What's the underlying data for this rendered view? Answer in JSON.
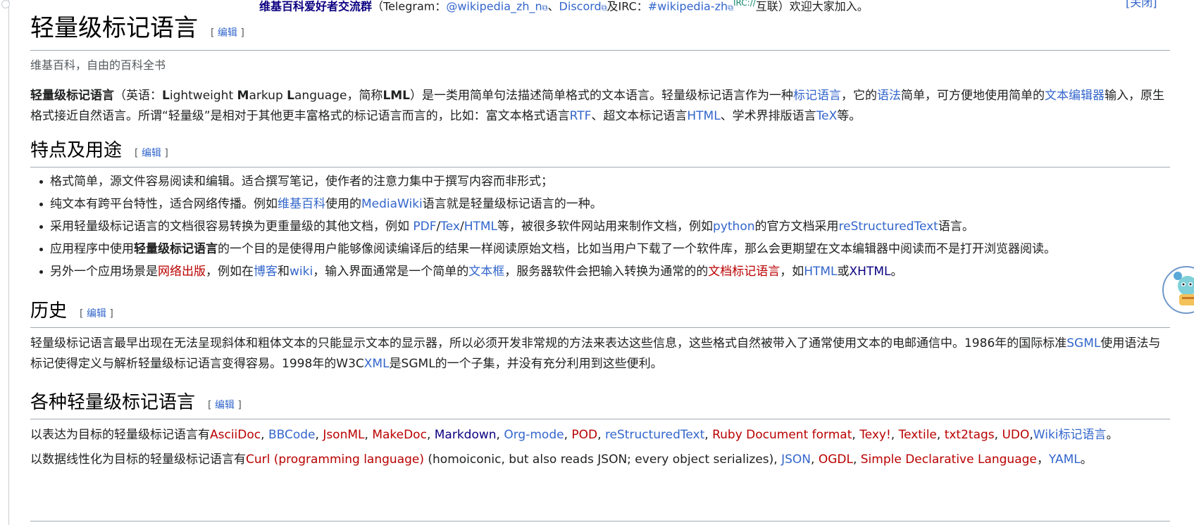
{
  "sitenotice": {
    "community": "维基百科爱好者交流群",
    "open_paren": "（Telegram：",
    "telegram": "@wikipedia_zh_n",
    "sep1": "、",
    "discord": "Discord",
    "irc_prefix": "及IRC：",
    "irc": "#wikipedia-zh",
    "irc_sup": "IRC://",
    "tail": "互联）欢迎大家加入。",
    "close": "[关闭]"
  },
  "edit_label": "编辑",
  "page": {
    "title": "轻量级标记语言",
    "tagline": "维基百科，自由的百科全书"
  },
  "lead": {
    "term": "轻量级标记语言",
    "t1": "（英语：",
    "eng_L": "L",
    "eng_ightweight": "ightweight ",
    "eng_M": "M",
    "eng_arkup": "arkup ",
    "eng_L2": "L",
    "eng_anguage": "anguage",
    "t2": "，简称",
    "abbr": "LML",
    "t3": "）是一类用简单句法描述简单格式的文本语言。轻量级标记语言作为一种",
    "link_markup": "标记语言",
    "t4": "，它的",
    "link_syntax": "语法",
    "t5": "简单，可方便地使用简单的",
    "link_editor": "文本编辑器",
    "t6": "输入，原生格式接近自然语言。所谓“轻量级”是相对于其他更丰富格式的标记语言而言的，比如：富文本格式语言",
    "link_rtf": "RTF",
    "t7": "、超文本标记语言",
    "link_html": "HTML",
    "t8": "、学术界排版语言",
    "link_tex": "TeX",
    "t9": "等。"
  },
  "features": {
    "heading": "特点及用途",
    "b1": "格式简单，源文件容易阅读和编辑。适合撰写笔记，使作者的注意力集中于撰写内容而非形式；",
    "b2_t1": "纯文本有跨平台特性，适合网络传播。例如",
    "b2_link_wp": "维基百科",
    "b2_t2": "使用的",
    "b2_link_mw": "MediaWiki",
    "b2_t3": "语言就是轻量级标记语言的一种。",
    "b3_t1": "采用轻量级标记语言的文档很容易转换为更重量级的其他文档，例如 ",
    "b3_pdf": "PDF",
    "b3_slash1": "/",
    "b3_tex": "Tex",
    "b3_slash2": "/",
    "b3_html": "HTML",
    "b3_t2": "等，被很多软件网站用来制作文档，例如",
    "b3_python": "python",
    "b3_t3": "的官方文档采用",
    "b3_rst": "reStructuredText",
    "b3_t4": "语言。",
    "b4_t1": "应用程序中使用",
    "b4_bold": "轻量级标记语言",
    "b4_t2": "的一个目的是使得用户能够像阅读编译后的结果一样阅读原始文档，比如当用户下载了一个软件库，那么会更期望在文本编辑器中阅读而不是打开浏览器阅读。",
    "b5_t1": "另外一个应用场景是",
    "b5_publish": "网络出版",
    "b5_t2": "，例如在",
    "b5_blog": "博客",
    "b5_and": "和",
    "b5_wiki": "wiki",
    "b5_t3": "，输入界面通常是一个简单的",
    "b5_textbox": "文本框",
    "b5_t4": "，服务器软件会把输入转换为通常的的",
    "b5_docmarkup": "文档标记语言",
    "b5_t5": "，如",
    "b5_html": "HTML",
    "b5_or": "或",
    "b5_xhtml": "XHTML",
    "b5_end": "。"
  },
  "history": {
    "heading": "历史",
    "t1": "轻量级标记语言最早出现在无法呈现斜体和粗体文本的只能显示文本的显示器，所以必须开发非常规的方法来表达这些信息，这些格式自然被带入了通常使用文本的电邮通信中。1986年的国际标准",
    "sgml": "SGML",
    "t2": "使用语法与标记使得定义与解析轻量级标记语言变得容易。1998年的W3C",
    "xml": "XML",
    "t3": "是SGML的一个子集，并没有充分利用到这些便利。"
  },
  "kinds": {
    "heading": "各种轻量级标记语言",
    "p1_lead": "以表达为目标的轻量级标记语言有",
    "p1_items": [
      {
        "label": "AsciiDoc",
        "kind": "redlink",
        "sep": ", "
      },
      {
        "label": "BBCode",
        "kind": "link",
        "sep": ", "
      },
      {
        "label": "JsonML",
        "kind": "redlink",
        "sep": ", "
      },
      {
        "label": "MakeDoc",
        "kind": "redlink",
        "sep": ", "
      },
      {
        "label": "Markdown",
        "kind": "visited",
        "sep": ", "
      },
      {
        "label": "Org-mode",
        "kind": "link",
        "sep": ", "
      },
      {
        "label": "POD",
        "kind": "redlink",
        "sep": ", "
      },
      {
        "label": "reStructuredText",
        "kind": "link",
        "sep": ", "
      },
      {
        "label": "Ruby Document format",
        "kind": "redlink",
        "sep": ", "
      },
      {
        "label": "Texy!",
        "kind": "redlink",
        "sep": ", "
      },
      {
        "label": "Textile",
        "kind": "redlink",
        "sep": ", "
      },
      {
        "label": "txt2tags",
        "kind": "redlink",
        "sep": ", "
      },
      {
        "label": "UDO",
        "kind": "redlink",
        "sep": ","
      },
      {
        "label": "Wiki标记语言",
        "kind": "link",
        "sep": "。"
      }
    ],
    "p2_lead": "以数据线性化为目标的轻量级标记语言有",
    "p2_curl": "Curl (programming language)",
    "p2_t1": " (homoiconic, but also reads JSON; every object serializes), ",
    "p2_json": "JSON",
    "p2_sep1": ", ",
    "p2_ogdl": "OGDL",
    "p2_sep2": ", ",
    "p2_sdl": "Simple Declarative Language",
    "p2_sep3": "，",
    "p2_yaml": "YAML",
    "p2_end": "。"
  }
}
